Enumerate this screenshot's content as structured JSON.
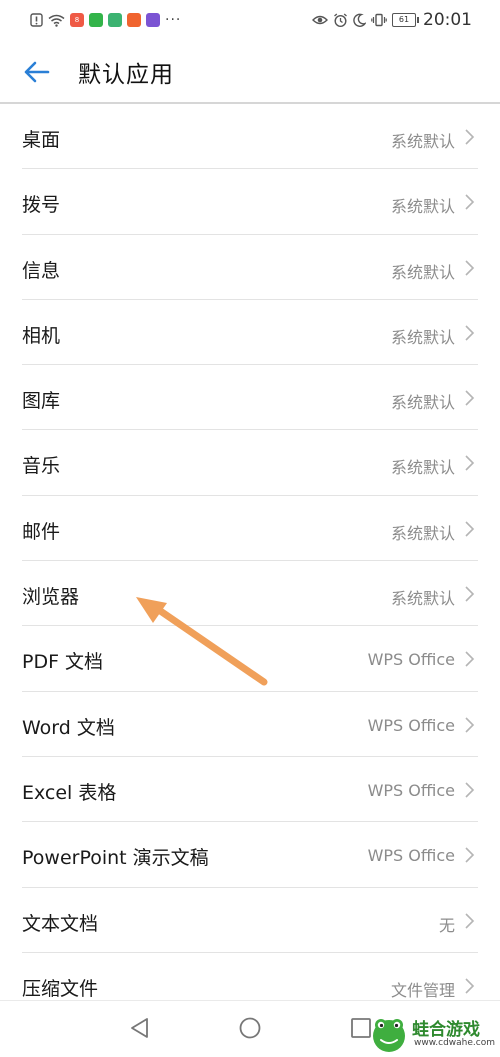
{
  "status_bar": {
    "time": "20:01",
    "battery": "61",
    "app_badges": [
      {
        "name": "app-badge-1",
        "color": "#ef5a45",
        "text": "8"
      },
      {
        "name": "app-badge-2",
        "color": "#33b44a",
        "text": ""
      },
      {
        "name": "app-badge-3",
        "color": "#3cb371",
        "text": ""
      },
      {
        "name": "app-badge-4",
        "color": "#f0642f",
        "text": ""
      },
      {
        "name": "app-badge-5",
        "color": "#7b54d3",
        "text": ""
      }
    ],
    "dots": "···"
  },
  "header": {
    "title": "默认应用"
  },
  "items": [
    {
      "label": "桌面",
      "value": "系统默认"
    },
    {
      "label": "拨号",
      "value": "系统默认"
    },
    {
      "label": "信息",
      "value": "系统默认"
    },
    {
      "label": "相机",
      "value": "系统默认"
    },
    {
      "label": "图库",
      "value": "系统默认"
    },
    {
      "label": "音乐",
      "value": "系统默认"
    },
    {
      "label": "邮件",
      "value": "系统默认"
    },
    {
      "label": "浏览器",
      "value": "系统默认"
    },
    {
      "label": "PDF 文档",
      "value": "WPS Office"
    },
    {
      "label": "Word 文档",
      "value": "WPS Office"
    },
    {
      "label": "Excel 表格",
      "value": "WPS Office"
    },
    {
      "label": "PowerPoint 演示文稿",
      "value": "WPS Office"
    },
    {
      "label": "文本文档",
      "value": "无"
    },
    {
      "label": "压缩文件",
      "value": "文件管理"
    }
  ],
  "annotation": {
    "arrow_color": "#f0a05a"
  },
  "watermark": {
    "title": "蛙合游戏",
    "url": "www.cdwahe.com"
  },
  "colors": {
    "accent": "#2a7fd6"
  }
}
